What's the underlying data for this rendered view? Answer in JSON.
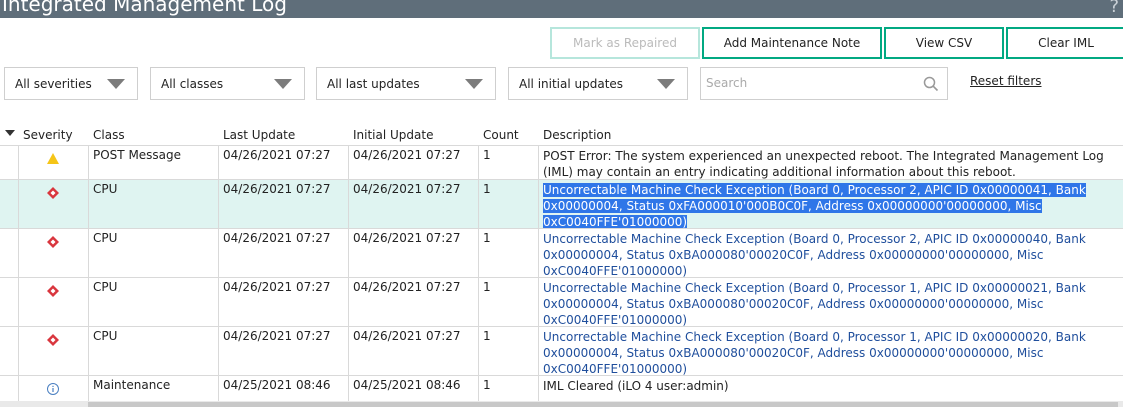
{
  "window": {
    "title": "Integrated Management Log",
    "help_label": "?"
  },
  "actions": {
    "mark_repaired": "Mark as Repaired",
    "add_note": "Add Maintenance Note",
    "view_csv": "View CSV",
    "clear_iml": "Clear IML"
  },
  "filters": {
    "severity": "All severities",
    "class": "All classes",
    "last_update": "All last updates",
    "initial_update": "All initial updates",
    "search_placeholder": "Search",
    "reset_label": "Reset filters"
  },
  "table": {
    "columns": [
      "Severity",
      "Class",
      "Last Update",
      "Initial Update",
      "Count",
      "Description"
    ],
    "rows": [
      {
        "severity": "warning",
        "class": "POST Message",
        "last_update": "04/26/2021 07:27",
        "initial_update": "04/26/2021 07:27",
        "count": "1",
        "description": "POST Error: The system experienced an unexpected reboot. The Integrated Management Log (IML) may contain an entry indicating additional information about this reboot."
      },
      {
        "severity": "critical",
        "class": "CPU",
        "last_update": "04/26/2021 07:27",
        "initial_update": "04/26/2021 07:27",
        "count": "1",
        "description": "Uncorrectable Machine Check Exception (Board 0, Processor 2, APIC ID 0x00000041, Bank 0x00000004, Status 0xFA000010'000B0C0F, Address 0x00000000'00000000, Misc 0xC0040FFE'01000000)",
        "selected": true
      },
      {
        "severity": "critical",
        "class": "CPU",
        "last_update": "04/26/2021 07:27",
        "initial_update": "04/26/2021 07:27",
        "count": "1",
        "description": "Uncorrectable Machine Check Exception (Board 0, Processor 2, APIC ID 0x00000040, Bank 0x00000004, Status 0xBA000080'00020C0F, Address 0x00000000'00000000, Misc 0xC0040FFE'01000000)"
      },
      {
        "severity": "critical",
        "class": "CPU",
        "last_update": "04/26/2021 07:27",
        "initial_update": "04/26/2021 07:27",
        "count": "1",
        "description": "Uncorrectable Machine Check Exception (Board 0, Processor 1, APIC ID 0x00000021, Bank 0x00000004, Status 0xBA000080'00020C0F, Address 0x00000000'00000000, Misc 0xC0040FFE'01000000)"
      },
      {
        "severity": "critical",
        "class": "CPU",
        "last_update": "04/26/2021 07:27",
        "initial_update": "04/26/2021 07:27",
        "count": "1",
        "description": "Uncorrectable Machine Check Exception (Board 0, Processor 1, APIC ID 0x00000020, Bank 0x00000004, Status 0xBA000080'00020C0F, Address 0x00000000'00000000, Misc 0xC0040FFE'01000000)"
      },
      {
        "severity": "info",
        "class": "Maintenance",
        "last_update": "04/25/2021 08:46",
        "initial_update": "04/25/2021 08:46",
        "count": "1",
        "description": "IML Cleared (iLO 4 user:admin)"
      }
    ]
  },
  "colors": {
    "titlebar": "#5f6e7a",
    "accent": "#01a982",
    "selected_row": "#dff4f1",
    "link": "#1f4e9c",
    "highlight": "#2f76e8",
    "critical": "#d9363e",
    "warning": "#f5c518",
    "info": "#4a7fc1"
  },
  "icons": {
    "warning": "warning-triangle-icon",
    "critical": "critical-diamond-icon",
    "info": "info-circle-icon"
  }
}
